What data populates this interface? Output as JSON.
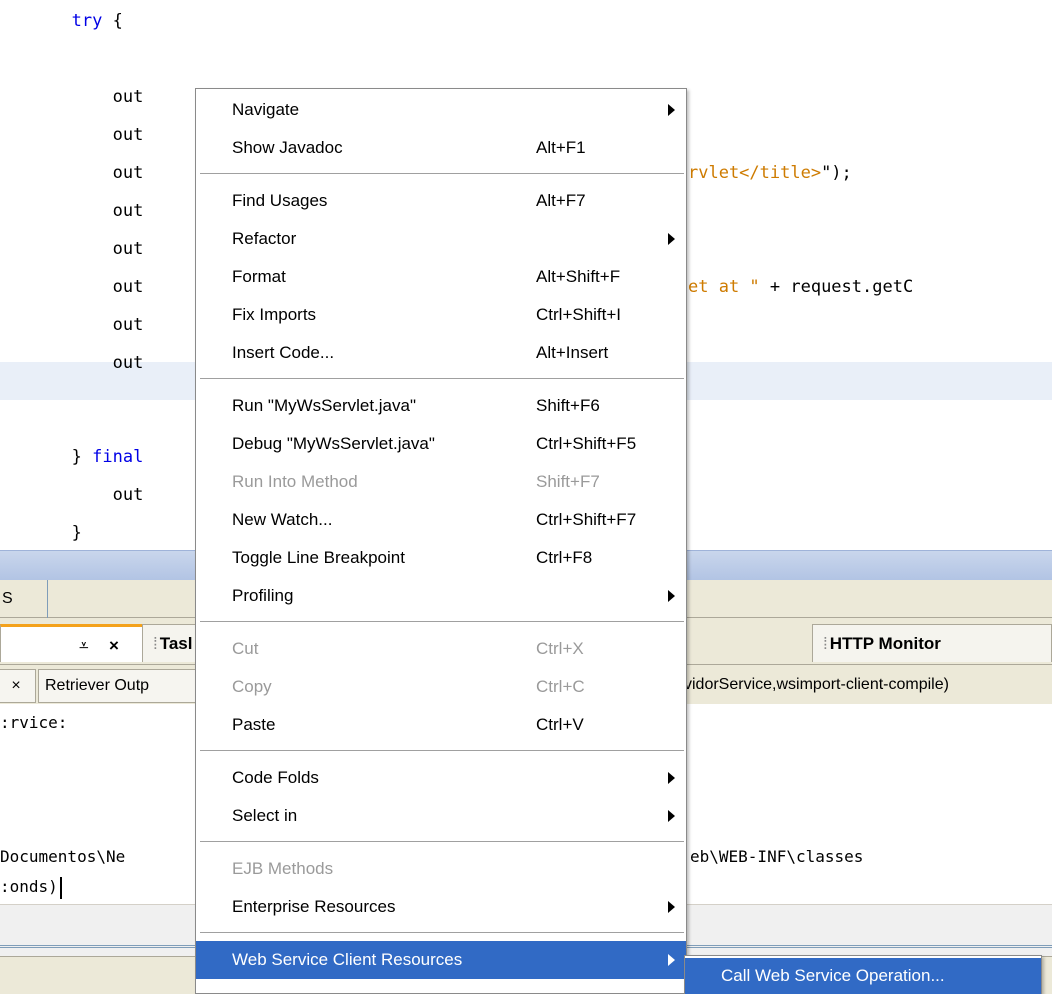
{
  "editor": {
    "lines": [
      {
        "indent": "       ",
        "parts": [
          {
            "t": "try",
            "c": "kw"
          },
          {
            "t": " {",
            "c": ""
          }
        ]
      },
      {
        "indent": "           ",
        "parts": [
          {
            "t": "out",
            "c": ""
          }
        ]
      },
      {
        "indent": "           ",
        "parts": [
          {
            "t": "out",
            "c": ""
          }
        ]
      },
      {
        "indent": "           ",
        "parts": [
          {
            "t": "out",
            "c": ""
          }
        ]
      },
      {
        "indent": "           ",
        "parts": [
          {
            "t": "out",
            "c": ""
          }
        ]
      },
      {
        "indent": "           ",
        "parts": [
          {
            "t": "out",
            "c": ""
          }
        ]
      },
      {
        "indent": "           ",
        "parts": [
          {
            "t": "out",
            "c": ""
          }
        ]
      },
      {
        "indent": "           ",
        "parts": [
          {
            "t": "out",
            "c": ""
          }
        ]
      },
      {
        "indent": "           ",
        "parts": [
          {
            "t": "out",
            "c": ""
          }
        ]
      },
      {
        "indent": "       ",
        "parts": [
          {
            "t": "} ",
            "c": ""
          },
          {
            "t": "final",
            "c": "kw"
          }
        ]
      },
      {
        "indent": "           ",
        "parts": [
          {
            "t": "out",
            "c": ""
          }
        ]
      },
      {
        "indent": "       ",
        "parts": [
          {
            "t": "}",
            "c": ""
          }
        ]
      }
    ],
    "fragments": [
      {
        "parts": [
          {
            "t": "rvlet</title>",
            "c": "str"
          },
          {
            "t": "\");",
            "c": ""
          }
        ]
      },
      {
        "parts": [
          {
            "t": "et at \"",
            "c": "str"
          },
          {
            "t": " + request.getC",
            "c": ""
          }
        ]
      }
    ]
  },
  "bottom": {
    "strip_tab": "S",
    "output_tab_close": "×",
    "tasks_tab": "Tasl",
    "http_tab": "HTTP Monitor",
    "subtab_close": "×",
    "retriever_tab": "Retriever Outp",
    "service_tab": "vidorService,wsimport-client-compile)",
    "output_lines": [
      ":rvice:",
      "Documentos\\Ne",
      ":onds)"
    ],
    "output_path_fragment": "eb\\WEB-INF\\classes"
  },
  "menu": {
    "items": [
      {
        "label": "Navigate",
        "shortcut": "",
        "submenu": true,
        "disabled": false
      },
      {
        "label": "Show Javadoc",
        "shortcut": "Alt+F1",
        "submenu": false,
        "disabled": false
      },
      {
        "sep": true
      },
      {
        "label": "Find Usages",
        "shortcut": "Alt+F7",
        "submenu": false,
        "disabled": false
      },
      {
        "label": "Refactor",
        "shortcut": "",
        "submenu": true,
        "disabled": false
      },
      {
        "label": "Format",
        "shortcut": "Alt+Shift+F",
        "submenu": false,
        "disabled": false
      },
      {
        "label": "Fix Imports",
        "shortcut": "Ctrl+Shift+I",
        "submenu": false,
        "disabled": false
      },
      {
        "label": "Insert Code...",
        "shortcut": "Alt+Insert",
        "submenu": false,
        "disabled": false
      },
      {
        "sep": true
      },
      {
        "label": "Run \"MyWsServlet.java\"",
        "shortcut": "Shift+F6",
        "submenu": false,
        "disabled": false
      },
      {
        "label": "Debug \"MyWsServlet.java\"",
        "shortcut": "Ctrl+Shift+F5",
        "submenu": false,
        "disabled": false
      },
      {
        "label": "Run Into Method",
        "shortcut": "Shift+F7",
        "submenu": false,
        "disabled": true
      },
      {
        "label": "New Watch...",
        "shortcut": "Ctrl+Shift+F7",
        "submenu": false,
        "disabled": false
      },
      {
        "label": "Toggle Line Breakpoint",
        "shortcut": "Ctrl+F8",
        "submenu": false,
        "disabled": false
      },
      {
        "label": "Profiling",
        "shortcut": "",
        "submenu": true,
        "disabled": false
      },
      {
        "sep": true
      },
      {
        "label": "Cut",
        "shortcut": "Ctrl+X",
        "submenu": false,
        "disabled": true
      },
      {
        "label": "Copy",
        "shortcut": "Ctrl+C",
        "submenu": false,
        "disabled": true
      },
      {
        "label": "Paste",
        "shortcut": "Ctrl+V",
        "submenu": false,
        "disabled": false
      },
      {
        "sep": true
      },
      {
        "label": "Code Folds",
        "shortcut": "",
        "submenu": true,
        "disabled": false
      },
      {
        "label": "Select in",
        "shortcut": "",
        "submenu": true,
        "disabled": false
      },
      {
        "sep": true
      },
      {
        "label": "EJB Methods",
        "shortcut": "",
        "submenu": false,
        "disabled": true
      },
      {
        "label": "Enterprise Resources",
        "shortcut": "",
        "submenu": true,
        "disabled": false
      },
      {
        "sep": true
      },
      {
        "label": "Web Service Client Resources",
        "shortcut": "",
        "submenu": true,
        "disabled": false,
        "highlighted": true
      }
    ]
  },
  "submenu": {
    "items": [
      {
        "label": "Call Web Service Operation...",
        "highlighted": true
      }
    ]
  },
  "colors": {
    "keyword": "#0000e6",
    "string": "#ce7b00",
    "selection": "#316ac5",
    "disabled_text": "#9a9a9a",
    "current_line": "#e9eff8"
  }
}
